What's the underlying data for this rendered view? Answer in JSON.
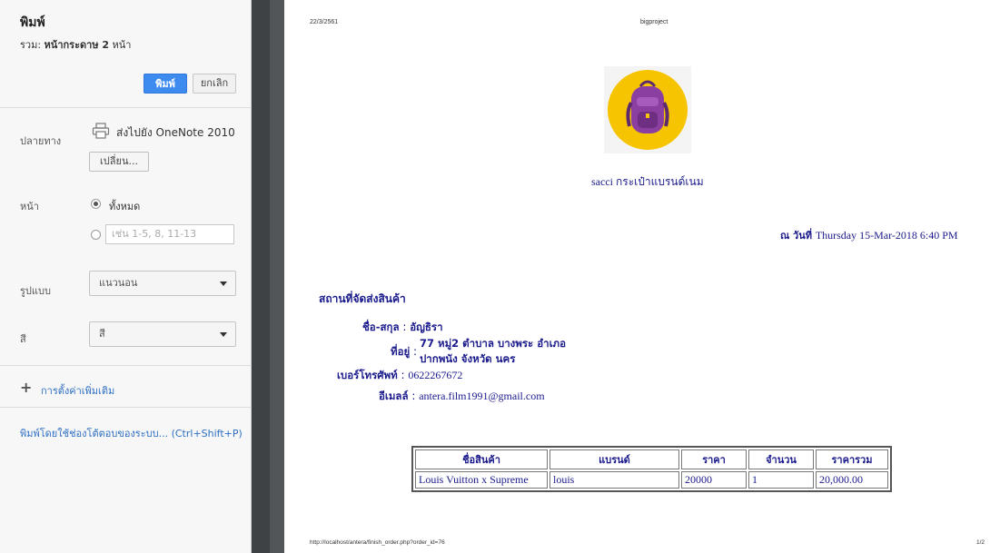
{
  "sidebar": {
    "title": "พิมพ์",
    "total_prefix": "รวม: ",
    "total_value": "หน้ากระดาษ 2",
    "total_suffix": " หน้า",
    "print_label": "พิมพ์",
    "cancel_label": "ยกเลิก",
    "destination_label": "ปลายทาง",
    "destination_name": "ส่งไปยัง OneNote 2010",
    "change_label": "เปลี่ยน...",
    "pages_label": "หน้า",
    "pages_all_label": "ทั้งหมด",
    "pages_placeholder": "เช่น 1-5, 8, 11-13",
    "layout_label": "รูปแบบ",
    "layout_value": "แนวนอน",
    "color_label": "สี",
    "color_value": "สี",
    "more_settings": "การตั้งค่าเพิ่มเติม",
    "system_dialog": "พิมพ์โดยใช้ช่องโต้ตอบของระบบ... (Ctrl+Shift+P)"
  },
  "paper": {
    "header_date": "22/3/2561",
    "header_title": "bigproject",
    "shop_name_latin": "sacci ",
    "shop_name_thai": "กระเป๋าแบรนด์เนม",
    "date_prefix": "ณ วันที่ ",
    "date_value": "Thursday 15-Mar-2018 6:40 PM",
    "ship_title": "สถานที่จัดส่งสินค้า",
    "name_key": "ชื่อ-สกุล",
    "name_value": "อัญธิรา",
    "address_key": "ที่อยู่",
    "address_line1": "77 หมู่2 ตำบาล บางพระ อำเภอ",
    "address_line2": "ปากพนัง จังหวัด นคร",
    "phone_key": "เบอร์โทรศัพท์",
    "phone_value": "0622267672",
    "email_key": "อีเมลล์",
    "email_value": "antera.film1991@gmail.com",
    "table": {
      "headers": [
        "ชื่อสินค้า",
        "แบรนด์",
        "ราคา",
        "จำนวน",
        "ราคารวม"
      ],
      "rows": [
        [
          "Louis Vuitton x Supreme",
          "louis",
          "20000",
          "1",
          "20,000.00"
        ]
      ]
    },
    "footer_url": "http://localhost/antera/finish_order.php?order_id=76",
    "footer_page": "1/2"
  },
  "colors": {
    "accent": "#3d8bef",
    "logo_circle": "#f6c400",
    "bag_purple": "#8b3fa0",
    "text_blue": "#1a1a8c"
  }
}
